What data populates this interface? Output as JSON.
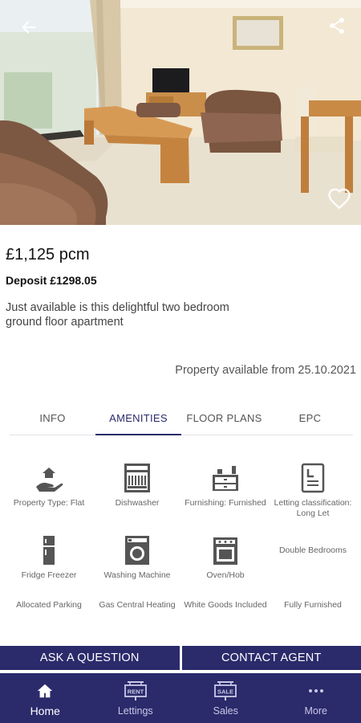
{
  "header": {
    "back_icon": "arrow-left-icon",
    "share_icon": "share-icon",
    "favourite_icon": "heart-outline-icon"
  },
  "listing": {
    "price": "£1,125 pcm",
    "deposit": "Deposit £1298.05",
    "summary": "Just available is this delightful two bedroom ground floor apartment",
    "available": "Property available from 25.10.2021"
  },
  "tabs": [
    {
      "label": "INFO",
      "active": false
    },
    {
      "label": "AMENITIES",
      "active": true
    },
    {
      "label": "FLOOR PLANS",
      "active": false
    },
    {
      "label": "EPC",
      "active": false
    }
  ],
  "amenities": [
    {
      "label": "Property Type: Flat",
      "icon": "hand-house-icon"
    },
    {
      "label": "Dishwasher",
      "icon": "dishwasher-icon"
    },
    {
      "label": "Furnishing: Furnished",
      "icon": "sideboard-icon"
    },
    {
      "label": "Letting classification: Long Let",
      "icon": "document-icon"
    },
    {
      "label": "Fridge Freezer",
      "icon": "fridge-icon"
    },
    {
      "label": "Washing Machine",
      "icon": "washing-machine-icon"
    },
    {
      "label": "Oven/Hob",
      "icon": "oven-icon"
    },
    {
      "label": "Double Bedrooms",
      "icon": ""
    },
    {
      "label": "Allocated Parking",
      "icon": ""
    },
    {
      "label": "Gas Central Heating",
      "icon": ""
    },
    {
      "label": "White Goods Included",
      "icon": ""
    },
    {
      "label": "Fully Furnished",
      "icon": ""
    }
  ],
  "actions": {
    "ask": "ASK A QUESTION",
    "contact": "CONTACT AGENT"
  },
  "nav": [
    {
      "label": "Home",
      "icon": "home-icon",
      "active": true
    },
    {
      "label": "Lettings",
      "icon": "rent-sign-icon",
      "badge": "RENT",
      "active": false
    },
    {
      "label": "Sales",
      "icon": "sale-sign-icon",
      "badge": "SALE",
      "active": false
    },
    {
      "label": "More",
      "icon": "more-dots-icon",
      "active": false
    }
  ],
  "colors": {
    "brand": "#2b2a6b",
    "text": "#222222",
    "muted": "#666666"
  }
}
